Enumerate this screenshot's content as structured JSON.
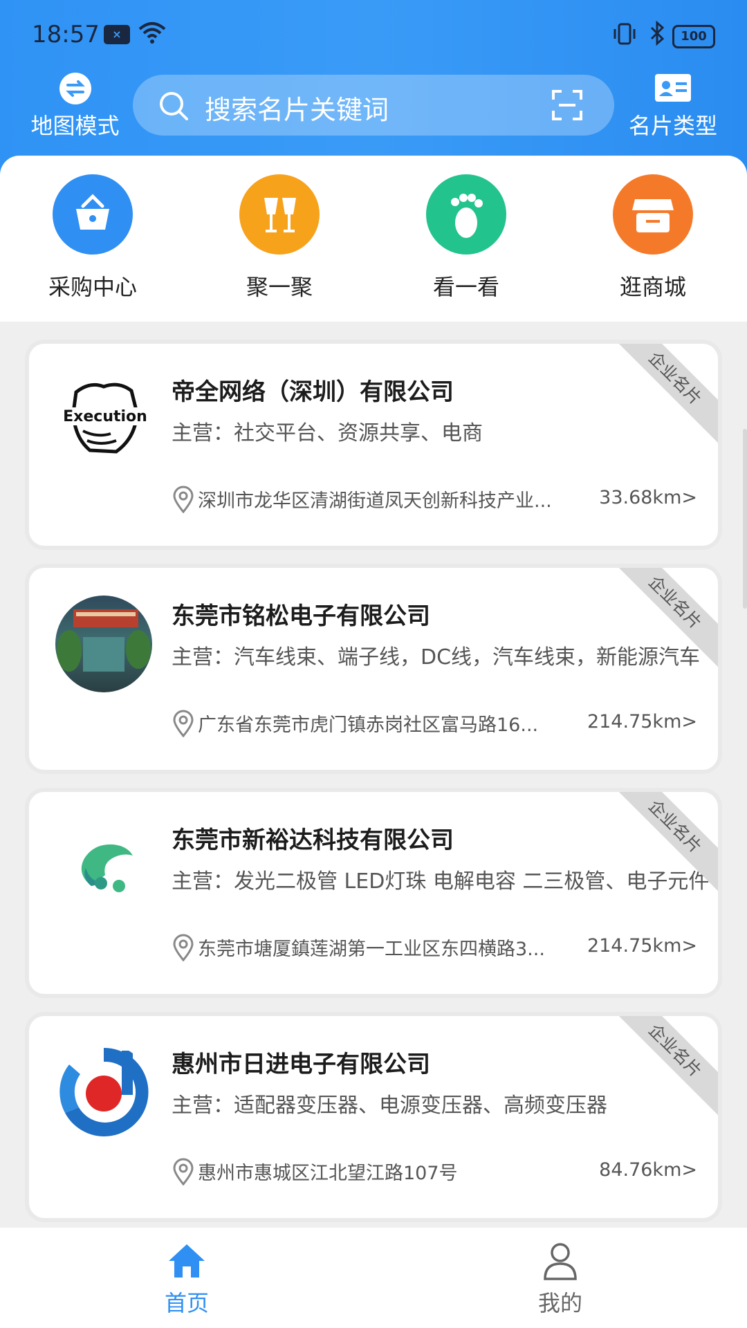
{
  "status": {
    "time": "18:57",
    "sim_label": "×",
    "battery": "100"
  },
  "header": {
    "map_mode_label": "地图模式",
    "search_placeholder": "搜索名片关键词",
    "card_type_label": "名片类型"
  },
  "quick_actions": [
    {
      "label": "采购中心",
      "icon": "shopping-basket-icon",
      "color": "#2f8ff2"
    },
    {
      "label": "聚一聚",
      "icon": "wine-glasses-icon",
      "color": "#f7a21b"
    },
    {
      "label": "看一看",
      "icon": "footprint-icon",
      "color": "#23c38e"
    },
    {
      "label": "逛商城",
      "icon": "store-icon",
      "color": "#f47a2a"
    }
  ],
  "cards": [
    {
      "name": "帝全网络（深圳）有限公司",
      "business": "主营：社交平台、资源共享、电商",
      "address": "深圳市龙华区清湖街道凤天创新科技产业...",
      "distance": "33.68km>",
      "badge": "企业名片",
      "logo": "fist-execution-logo",
      "logo_text": "Execution"
    },
    {
      "name": "东莞市铭松电子有限公司",
      "business": "主营：汽车线束、端子线，DC线，汽车线束，新能源汽车",
      "address": "广东省东莞市虎门镇赤岗社区富马路16...",
      "distance": "214.75km>",
      "badge": "企业名片",
      "logo": "office-photo-logo"
    },
    {
      "name": "东莞市新裕达科技有限公司",
      "business": "主营：发光二极管 LED灯珠 电解电容 二三极管、电子元件",
      "address": "东莞市塘厦鎮莲湖第一工业区东四横路3...",
      "distance": "214.75km>",
      "badge": "企业名片",
      "logo": "green-swirl-logo"
    },
    {
      "name": "惠州市日进电子有限公司",
      "business": "主营：适配器变压器、电源变压器、高频变压器",
      "address": "惠州市惠城区江北望江路107号",
      "distance": "84.76km>",
      "badge": "企业名片",
      "logo": "blue-red-circle-logo"
    }
  ],
  "bottom_nav": {
    "home_label": "首页",
    "mine_label": "我的",
    "active_color": "#2f8ff2",
    "inactive_color": "#666666"
  }
}
